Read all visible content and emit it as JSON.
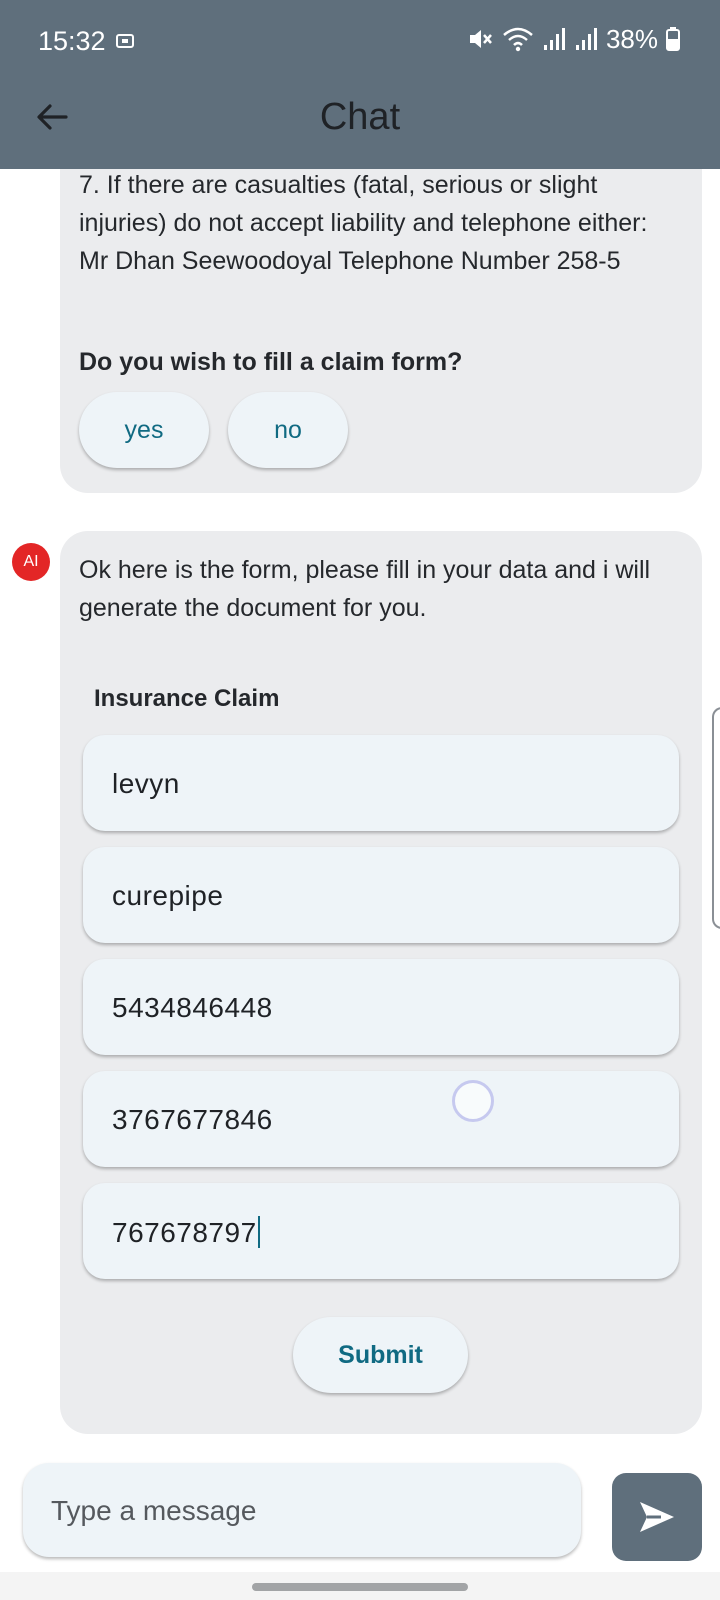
{
  "status_bar": {
    "time": "15:32",
    "battery_percent": "38%",
    "icons": [
      "screen-record-icon",
      "mute-icon",
      "wifi-icon",
      "signal-icon",
      "signal-icon",
      "battery-icon"
    ]
  },
  "header": {
    "title": "Chat",
    "back_icon": "arrow-left-icon"
  },
  "messages": [
    {
      "text": "7. If there are casualties (fatal, serious or slight injuries) do not accept liability and telephone either: Mr Dhan Seewoodoyal Telephone Number 258-5",
      "question": "Do you wish to fill a claim form?",
      "options": [
        "yes",
        "no"
      ]
    },
    {
      "avatar": "AI",
      "text": "Ok here is the form, please fill in your data and i will generate the document for you.",
      "form": {
        "title": "Insurance Claim",
        "fields": [
          "levyn",
          "curepipe",
          "5434846448",
          "3767677846",
          "767678797"
        ],
        "submit_label": "Submit"
      }
    }
  ],
  "composer": {
    "placeholder": "Type a message",
    "send_icon": "send-icon"
  },
  "colors": {
    "appbar": "#5f6f7c",
    "bubble": "#ebecee",
    "accent": "#106a82",
    "avatar": "#e32626"
  }
}
